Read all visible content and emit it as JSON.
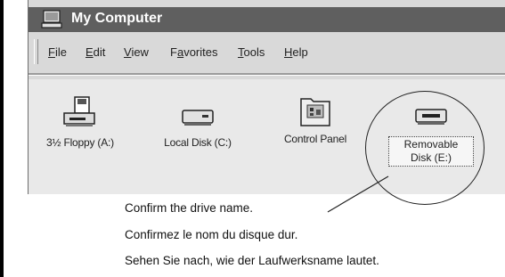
{
  "window": {
    "title": "My Computer"
  },
  "menu": [
    {
      "pre": "",
      "u": "F",
      "post": "ile"
    },
    {
      "pre": "",
      "u": "E",
      "post": "dit"
    },
    {
      "pre": "",
      "u": "V",
      "post": "iew"
    },
    {
      "pre": "F",
      "u": "a",
      "post": "vorites"
    },
    {
      "pre": "",
      "u": "T",
      "post": "ools"
    },
    {
      "pre": "",
      "u": "H",
      "post": "elp"
    }
  ],
  "drives": [
    {
      "label": "3½ Floppy (A:)",
      "icon": "floppy-drive-icon"
    },
    {
      "label": "Local Disk (C:)",
      "icon": "hard-disk-icon"
    },
    {
      "label": "Control Panel",
      "icon": "control-panel-icon"
    },
    {
      "label_line1": "Removable",
      "label_line2": "Disk (E:)",
      "icon": "removable-disk-icon"
    }
  ],
  "instructions": {
    "en": "Confirm the drive name.",
    "fr": "Confirmez le nom du disque dur.",
    "de": "Sehen Sie nach, wie der Laufwerksname lautet."
  }
}
